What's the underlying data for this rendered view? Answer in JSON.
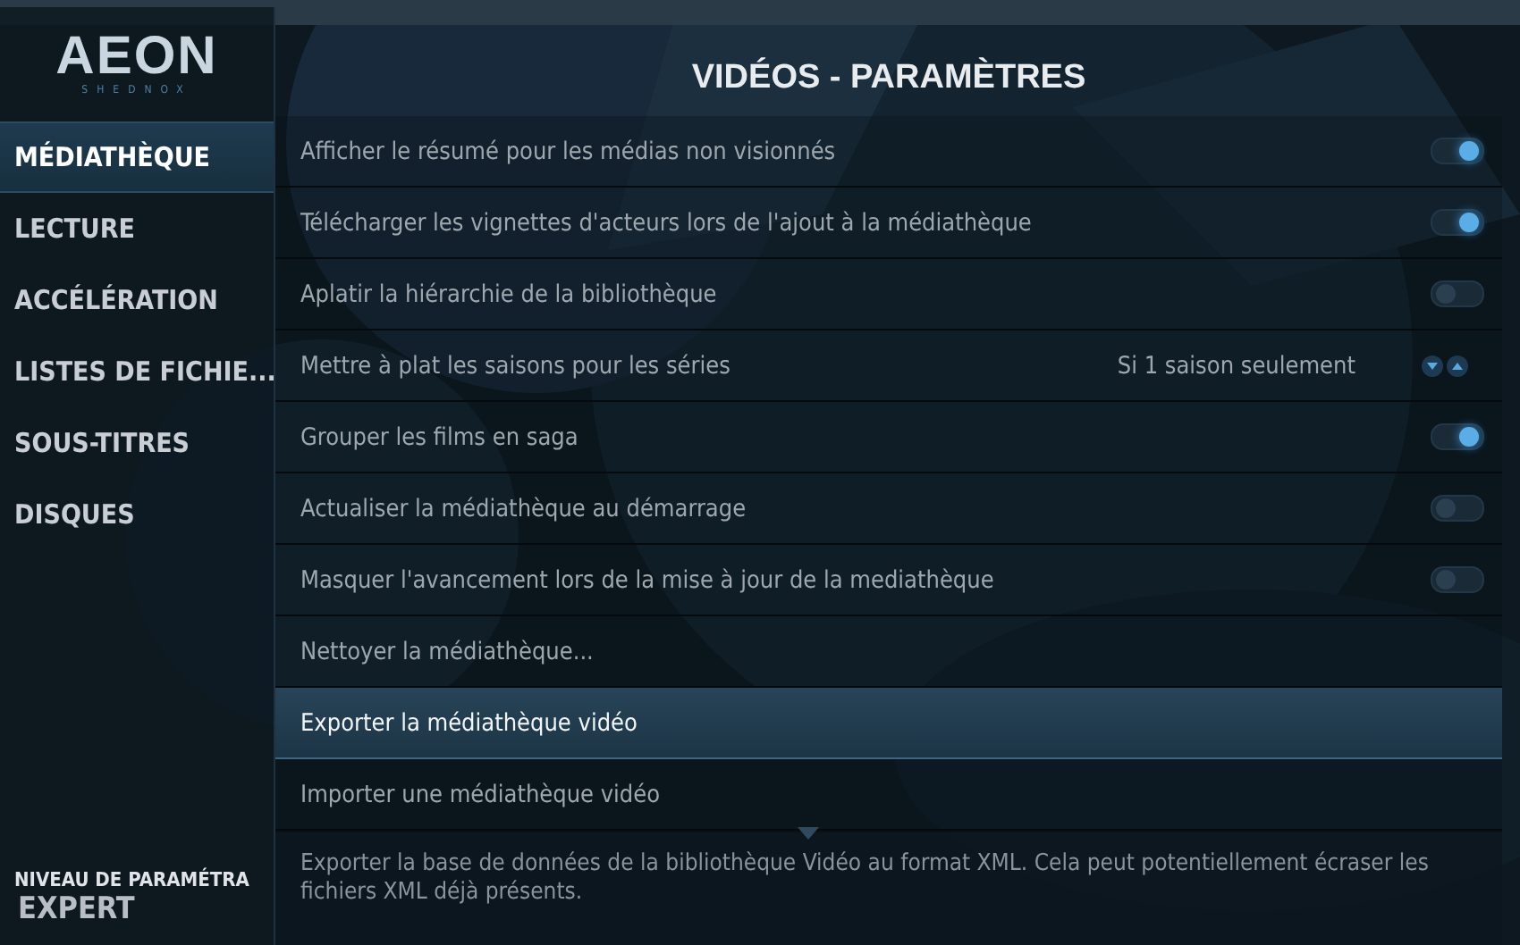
{
  "logo": {
    "title": "AEON",
    "subtitle": "SHEDNOX"
  },
  "sidebar": {
    "items": [
      {
        "label": "MÉDIATHÈQUE",
        "selected": true
      },
      {
        "label": "LECTURE",
        "selected": false
      },
      {
        "label": "ACCÉLÉRATION",
        "selected": false
      },
      {
        "label": "LISTES DE FICHIE...",
        "selected": false
      },
      {
        "label": "SOUS-TITRES",
        "selected": false
      },
      {
        "label": "DISQUES",
        "selected": false
      }
    ],
    "level_caption": "NIVEAU DE PARAMÉTRA",
    "level_value": "EXPERT"
  },
  "page_title": "VIDÉOS - PARAMÈTRES",
  "settings": [
    {
      "kind": "toggle",
      "label": "Afficher le résumé pour les médias non visionnés",
      "on": true,
      "selected": false
    },
    {
      "kind": "toggle",
      "label": "Télécharger les vignettes d'acteurs lors de l'ajout à la médiathèque",
      "on": true,
      "selected": false
    },
    {
      "kind": "toggle",
      "label": "Aplatir la hiérarchie de la bibliothèque",
      "on": false,
      "selected": false
    },
    {
      "kind": "spinner",
      "label": "Mettre à plat les saisons pour les séries",
      "value": "Si 1 saison seulement",
      "selected": false
    },
    {
      "kind": "toggle",
      "label": "Grouper les films en saga",
      "on": true,
      "selected": false
    },
    {
      "kind": "toggle",
      "label": "Actualiser la médiathèque au démarrage",
      "on": false,
      "selected": false
    },
    {
      "kind": "toggle",
      "label": "Masquer l'avancement lors de la mise à jour de la mediathèque",
      "on": false,
      "selected": false
    },
    {
      "kind": "action",
      "label": "Nettoyer la médiathèque...",
      "selected": false
    },
    {
      "kind": "action",
      "label": "Exporter la médiathèque vidéo",
      "selected": true
    },
    {
      "kind": "action",
      "label": "Importer une médiathèque vidéo",
      "selected": false
    }
  ],
  "description": "Exporter la base de données de la bibliothèque Vidéo au format XML. Cela peut potentiellement écraser les fichiers XML déjà présents."
}
